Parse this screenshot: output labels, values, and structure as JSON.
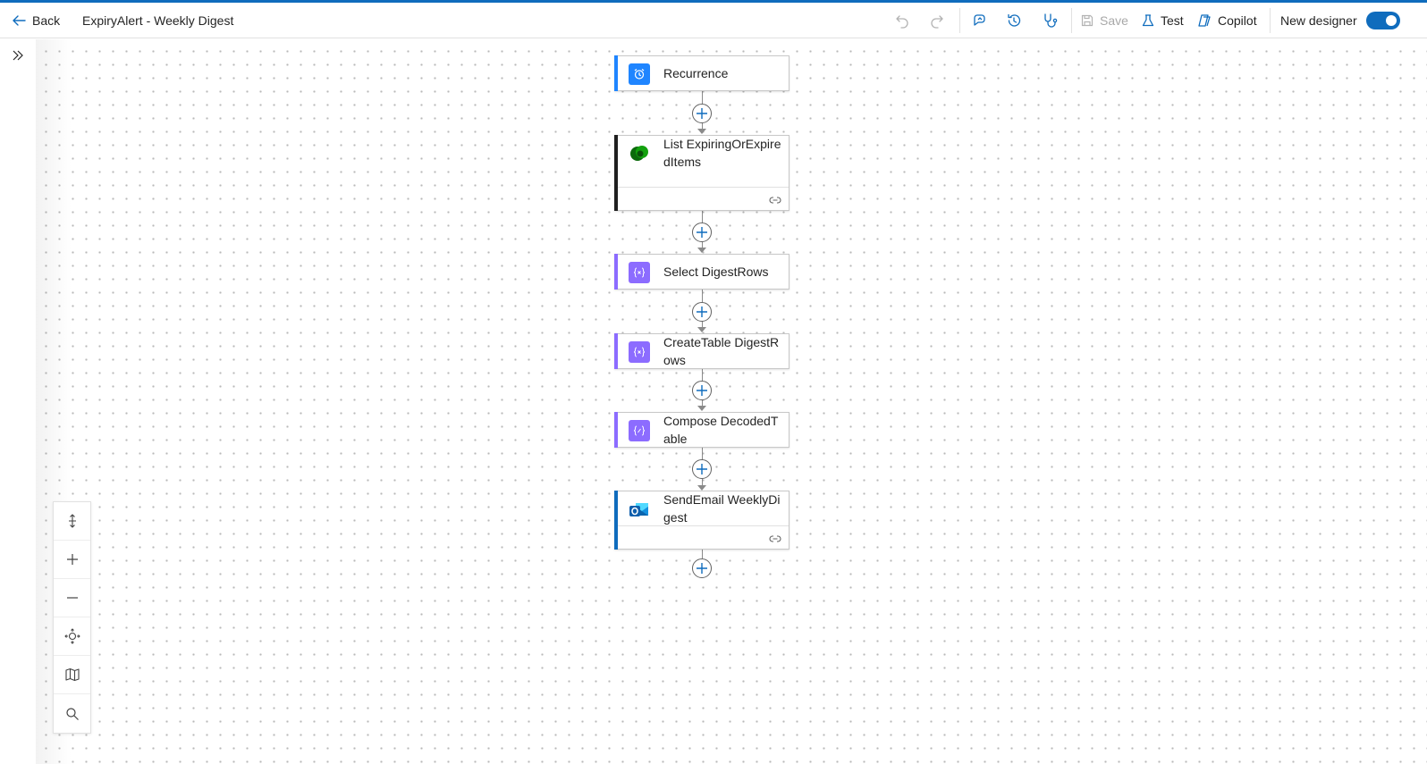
{
  "toolbar": {
    "back_label": "Back",
    "flow_title": "ExpiryAlert - Weekly Digest",
    "save_label": "Save",
    "test_label": "Test",
    "copilot_label": "Copilot",
    "new_designer_label": "New designer",
    "new_designer_enabled": true,
    "icons": [
      "undo-icon",
      "redo-icon",
      "flow-checker-icon",
      "version-history-icon",
      "stethoscope-icon",
      "save-icon",
      "beaker-icon",
      "copilot-icon"
    ]
  },
  "flow": {
    "steps": [
      {
        "label": "Recurrence",
        "icon": "alarm-clock-icon",
        "accent": "#1f85ff",
        "has_footer": false
      },
      {
        "label": "List ExpiringOrExpiredItems",
        "icon": "dataverse-icon",
        "accent": "#1f1f1f",
        "has_footer": true
      },
      {
        "label": "Select DigestRows",
        "icon": "data-operation-icon",
        "accent": "#8c6cff",
        "has_footer": false
      },
      {
        "label": "CreateTable DigestRows",
        "icon": "data-operation-icon",
        "accent": "#8c6cff",
        "has_footer": false
      },
      {
        "label": "Compose DecodedTable",
        "icon": "data-operation-icon",
        "accent": "#8c6cff",
        "has_footer": false
      },
      {
        "label": "SendEmail WeeklyDigest",
        "icon": "outlook-icon",
        "accent": "#0f6cbd",
        "has_footer": true
      }
    ]
  },
  "canvas_controls": [
    "fit-vertical-icon",
    "zoom-in-icon",
    "zoom-out-icon",
    "fit-view-icon",
    "minimap-icon",
    "search-icon"
  ],
  "colors": {
    "brand": "#0f6cbd",
    "data_operation": "#8c6cff",
    "recurrence": "#1f85ff"
  }
}
